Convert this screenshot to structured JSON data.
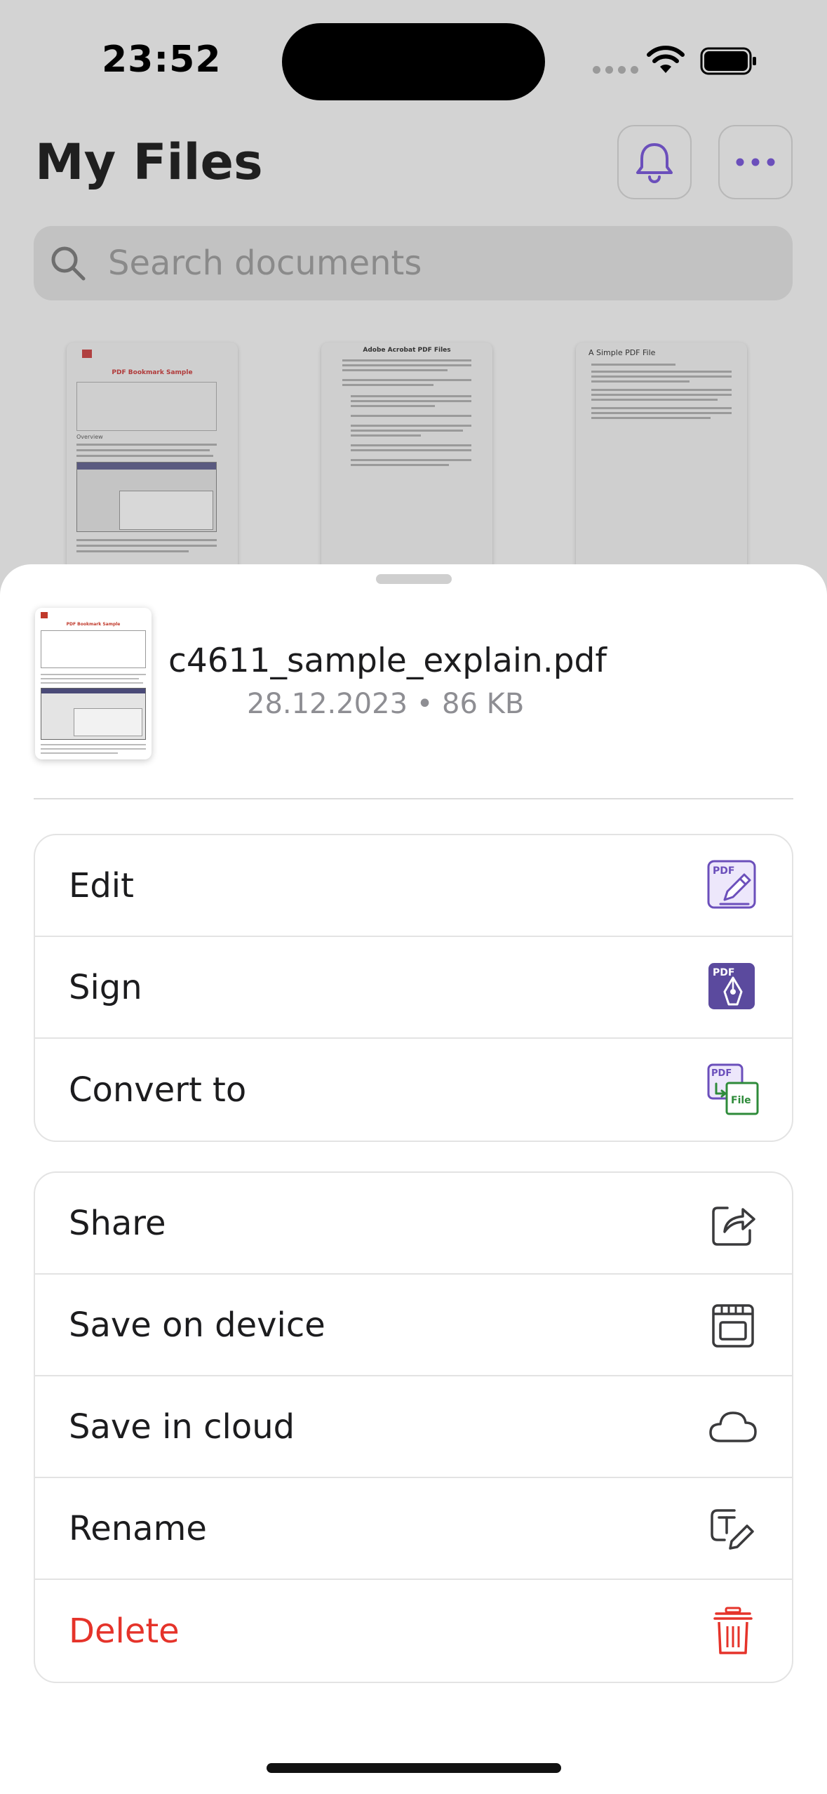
{
  "status_bar": {
    "time": "23:52"
  },
  "header": {
    "title": "My Files"
  },
  "search": {
    "placeholder": "Search documents"
  },
  "thumbnails": [
    {
      "title": "PDF Bookmark Sample",
      "subtitle": "Overview"
    },
    {
      "title": "Adobe Acrobat PDF Files"
    },
    {
      "title": "A Simple PDF File"
    }
  ],
  "file": {
    "name": "c4611_sample_explain.pdf",
    "meta": "28.12.2023 • 86 KB",
    "thumb_title": "PDF Bookmark Sample"
  },
  "actions_primary": [
    {
      "label": "Edit",
      "icon": "pdf-edit-icon"
    },
    {
      "label": "Sign",
      "icon": "pdf-sign-icon"
    },
    {
      "label": "Convert to",
      "icon": "pdf-convert-icon",
      "badge": "File"
    }
  ],
  "actions_secondary": [
    {
      "label": "Share",
      "icon": "share-icon"
    },
    {
      "label": "Save on device",
      "icon": "save-device-icon"
    },
    {
      "label": "Save in cloud",
      "icon": "cloud-icon"
    },
    {
      "label": "Rename",
      "icon": "rename-icon"
    },
    {
      "label": "Delete",
      "icon": "trash-icon"
    }
  ],
  "pdf_badge": "PDF",
  "colors": {
    "accent": "#6b4fbb",
    "danger": "#e5332a",
    "convert_green": "#2e8b3a"
  }
}
